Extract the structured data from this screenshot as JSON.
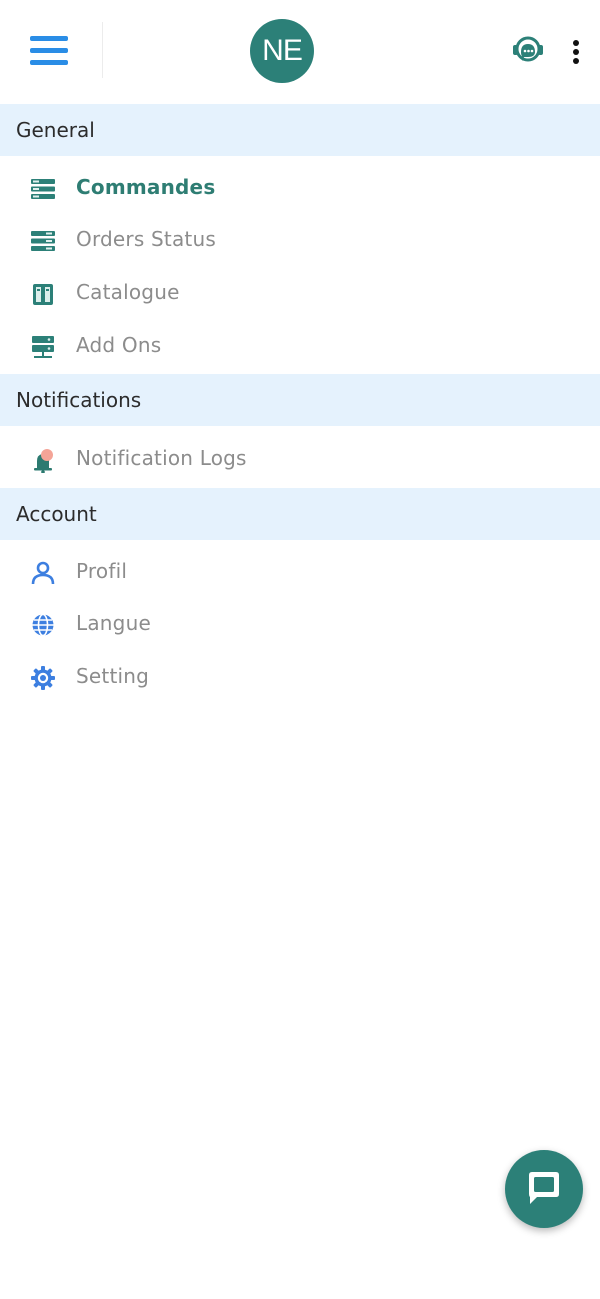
{
  "header": {
    "logo_text": "NE"
  },
  "sections": [
    {
      "title": "General",
      "items": [
        {
          "label": "Commandes",
          "icon": "orders-icon",
          "active": true
        },
        {
          "label": "Orders Status",
          "icon": "orders-status-icon"
        },
        {
          "label": "Catalogue",
          "icon": "catalogue-icon"
        },
        {
          "label": "Add Ons",
          "icon": "add-ons-icon"
        }
      ]
    },
    {
      "title": "Notifications",
      "items": [
        {
          "label": "Notification Logs",
          "icon": "notification-bell-icon"
        }
      ]
    },
    {
      "title": "Account",
      "items": [
        {
          "label": "Profil",
          "icon": "user-icon"
        },
        {
          "label": "Langue",
          "icon": "globe-icon"
        },
        {
          "label": "Setting",
          "icon": "gear-icon"
        }
      ]
    }
  ],
  "colors": {
    "primary": "#2c8078",
    "accent_blue": "#2a8de6",
    "section_bg": "#e5f2fd",
    "inactive_text": "#8c8c8c"
  }
}
